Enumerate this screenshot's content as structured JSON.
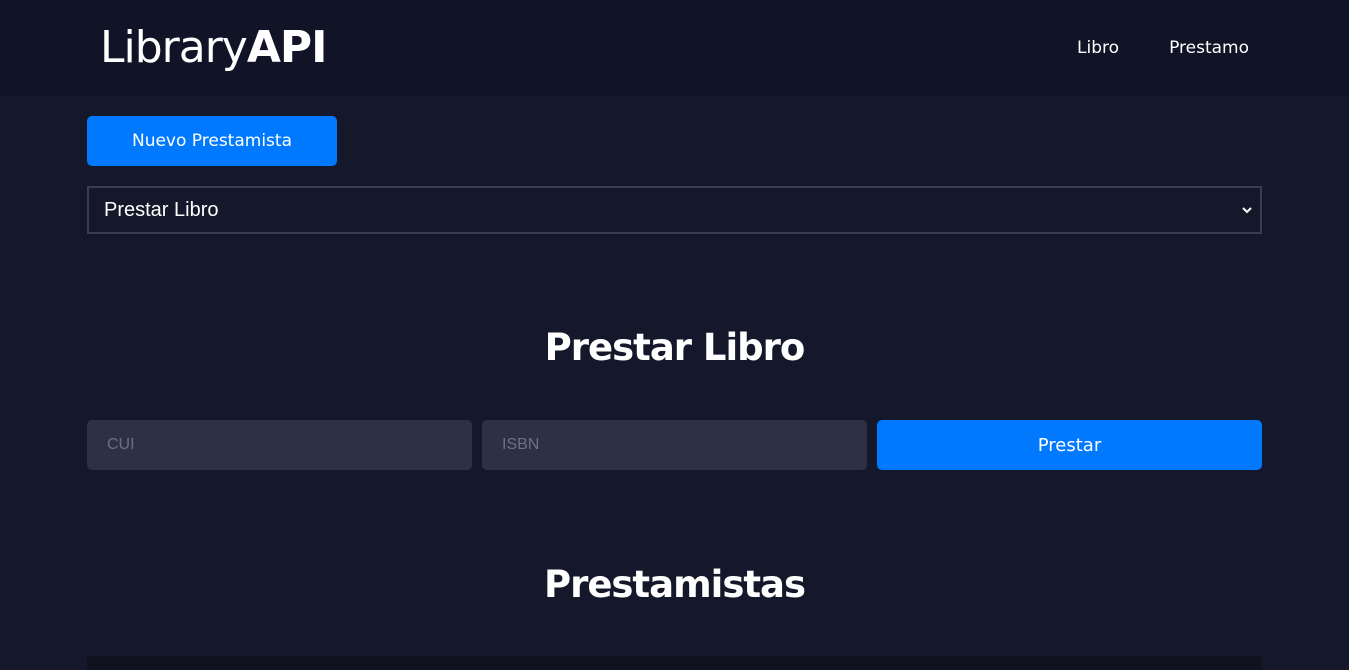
{
  "navbar": {
    "brand_light": "Library",
    "brand_bold": "API",
    "links": [
      {
        "label": "Libro"
      },
      {
        "label": "Prestamo"
      }
    ]
  },
  "actions": {
    "new_lender_label": "Nuevo Prestamista"
  },
  "selector": {
    "selected": "Prestar Libro"
  },
  "loan_form": {
    "title": "Prestar Libro",
    "cui_placeholder": "CUI",
    "isbn_placeholder": "ISBN",
    "submit_label": "Prestar"
  },
  "lenders": {
    "title": "Prestamistas"
  },
  "colors": {
    "background": "#15182a",
    "navbar": "#111326",
    "primary": "#0079fe",
    "input_bg": "#2e3145",
    "placeholder": "#6d7085"
  }
}
